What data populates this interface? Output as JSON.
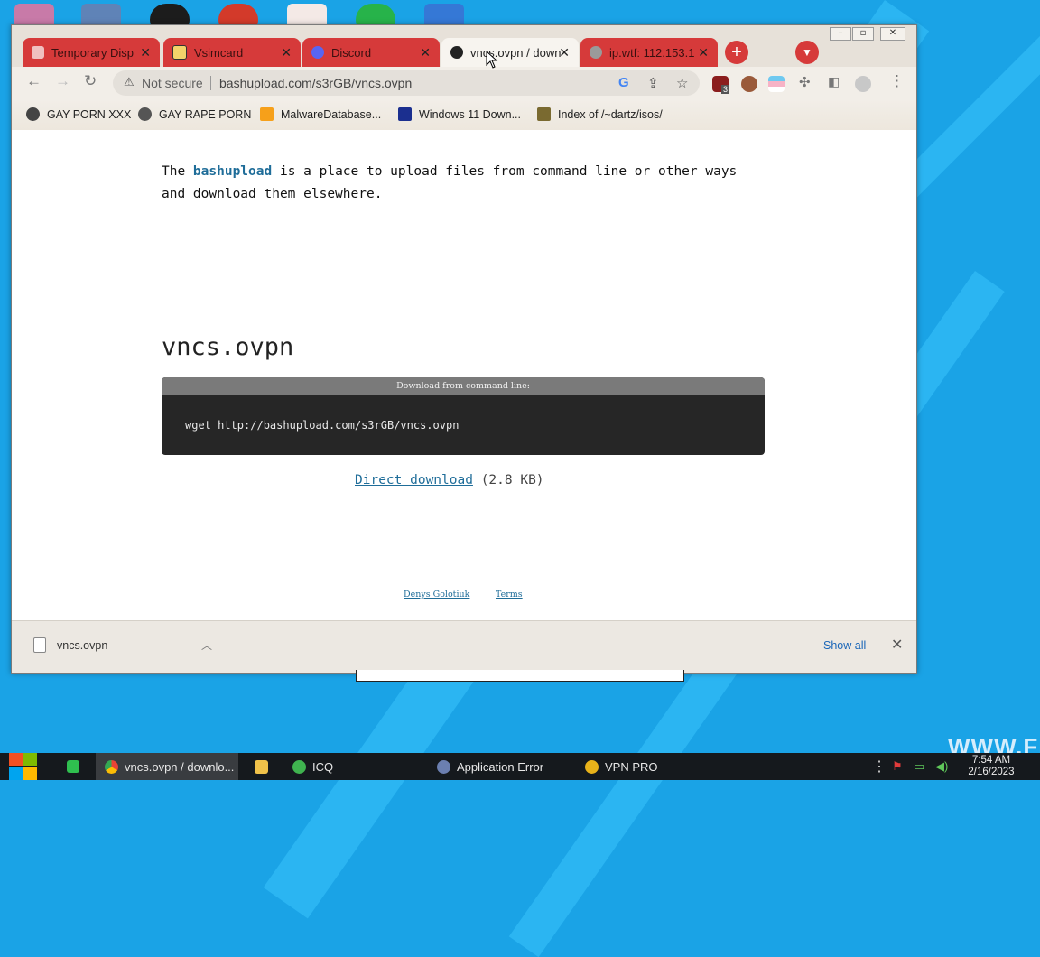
{
  "colors": {
    "desktop": "#1aa3e6",
    "tab_red": "#d63a3a",
    "link": "#1f6d99",
    "taskbar": "#15191d"
  },
  "desktop": {
    "watermark": "WWW.FR"
  },
  "browser": {
    "tabs": [
      {
        "label": "Temporary Disp",
        "icon": "mail-icon"
      },
      {
        "label": "Vsimcard",
        "icon": "sim-card-icon"
      },
      {
        "label": "Discord",
        "icon": "discord-icon"
      },
      {
        "label": "vncs.ovpn / down",
        "icon": "cloud-upload-icon",
        "active": true
      },
      {
        "label": "ip.wtf: 112.153.1",
        "icon": "globe-icon"
      }
    ],
    "address": {
      "security_label": "Not secure",
      "url": "bashupload.com/s3rGB/vncs.ovpn"
    },
    "extension_badge": "3",
    "bookmarks": [
      {
        "label": "GAY PORN XXX",
        "icon": "bookmark-site-icon"
      },
      {
        "label": "GAY RAPE PORN",
        "icon": "globe-icon"
      },
      {
        "label": "MalwareDatabase...",
        "icon": "ph-icon"
      },
      {
        "label": "Windows 11 Down...",
        "icon": "x-logo-icon"
      },
      {
        "label": "Index of /~dartz/isos/",
        "icon": "folder-tree-icon"
      }
    ]
  },
  "page": {
    "intro_before": "The ",
    "intro_link": "bashupload",
    "intro_after": " is a place to upload files from command line or other ways and download them elsewhere.",
    "filename": "vncs.ovpn",
    "cmd_header": "Download from command line:",
    "cmd": "wget http://bashupload.com/s3rGB/vncs.ovpn",
    "direct_download": "Direct download",
    "size": "(2.8 KB)",
    "footer_author": "Denys Golotiuk",
    "footer_terms": "Terms"
  },
  "download_bar": {
    "filename": "vncs.ovpn",
    "show_all": "Show all"
  },
  "taskbar": {
    "items": [
      {
        "label": "vncs.ovpn / downlo...",
        "icon": "chrome-icon",
        "active": true
      },
      {
        "label": "",
        "icon": "folder-icon"
      },
      {
        "label": "ICQ",
        "icon": "icq-icon"
      },
      {
        "label": "Application Error",
        "icon": "app-error-icon"
      },
      {
        "label": "VPN PRO",
        "icon": "vpn-icon"
      }
    ],
    "time": "7:54 AM",
    "date": "2/16/2023"
  }
}
